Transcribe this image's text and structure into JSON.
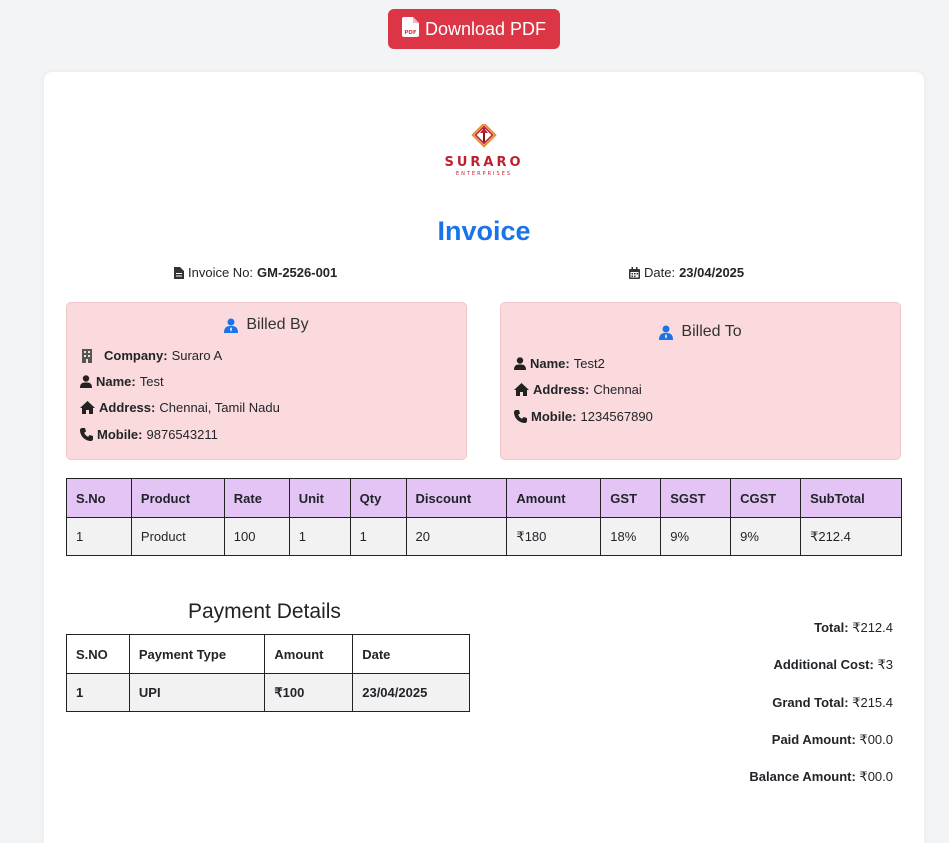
{
  "toolbar": {
    "download_label": "Download PDF"
  },
  "logo": {
    "name": "SURARO",
    "tagline": "ENTERPRISES"
  },
  "invoice": {
    "title": "Invoice",
    "number_label": "Invoice No:",
    "number": "GM-2526-001",
    "date_label": "Date:",
    "date": "23/04/2025"
  },
  "billed_by": {
    "heading": "Billed By",
    "company_label": "Company:",
    "company": "Suraro A",
    "name_label": "Name:",
    "name": "Test",
    "address_label": "Address:",
    "address": "Chennai, Tamil Nadu",
    "mobile_label": "Mobile:",
    "mobile": "9876543211"
  },
  "billed_to": {
    "heading": "Billed To",
    "name_label": "Name:",
    "name": "Test2",
    "address_label": "Address:",
    "address": "Chennai",
    "mobile_label": "Mobile:",
    "mobile": "1234567890"
  },
  "items_table": {
    "headers": [
      "S.No",
      "Product",
      "Rate",
      "Unit",
      "Qty",
      "Discount",
      "Amount",
      "GST",
      "SGST",
      "CGST",
      "SubTotal"
    ],
    "rows": [
      [
        "1",
        "Product",
        "100",
        "1",
        "1",
        "20",
        "₹180",
        "18%",
        "9%",
        "9%",
        "₹212.4"
      ]
    ]
  },
  "payment": {
    "title": "Payment Details",
    "headers": [
      "S.NO",
      "Payment Type",
      "Amount",
      "Date"
    ],
    "rows": [
      [
        "1",
        "UPI",
        "₹100",
        "23/04/2025"
      ]
    ]
  },
  "totals": {
    "total_label": "Total:",
    "total": "₹212.4",
    "additional_label": "Additional Cost:",
    "additional": "₹3",
    "grand_label": "Grand Total:",
    "grand": "₹215.4",
    "paid_label": "Paid Amount:",
    "paid": "₹00.0",
    "balance_label": "Balance Amount:",
    "balance": "₹00.0"
  },
  "colors": {
    "accent": "#1a73e8",
    "danger": "#dc3545",
    "party_bg": "#fadadd",
    "table_header": "#e4c4f5"
  }
}
